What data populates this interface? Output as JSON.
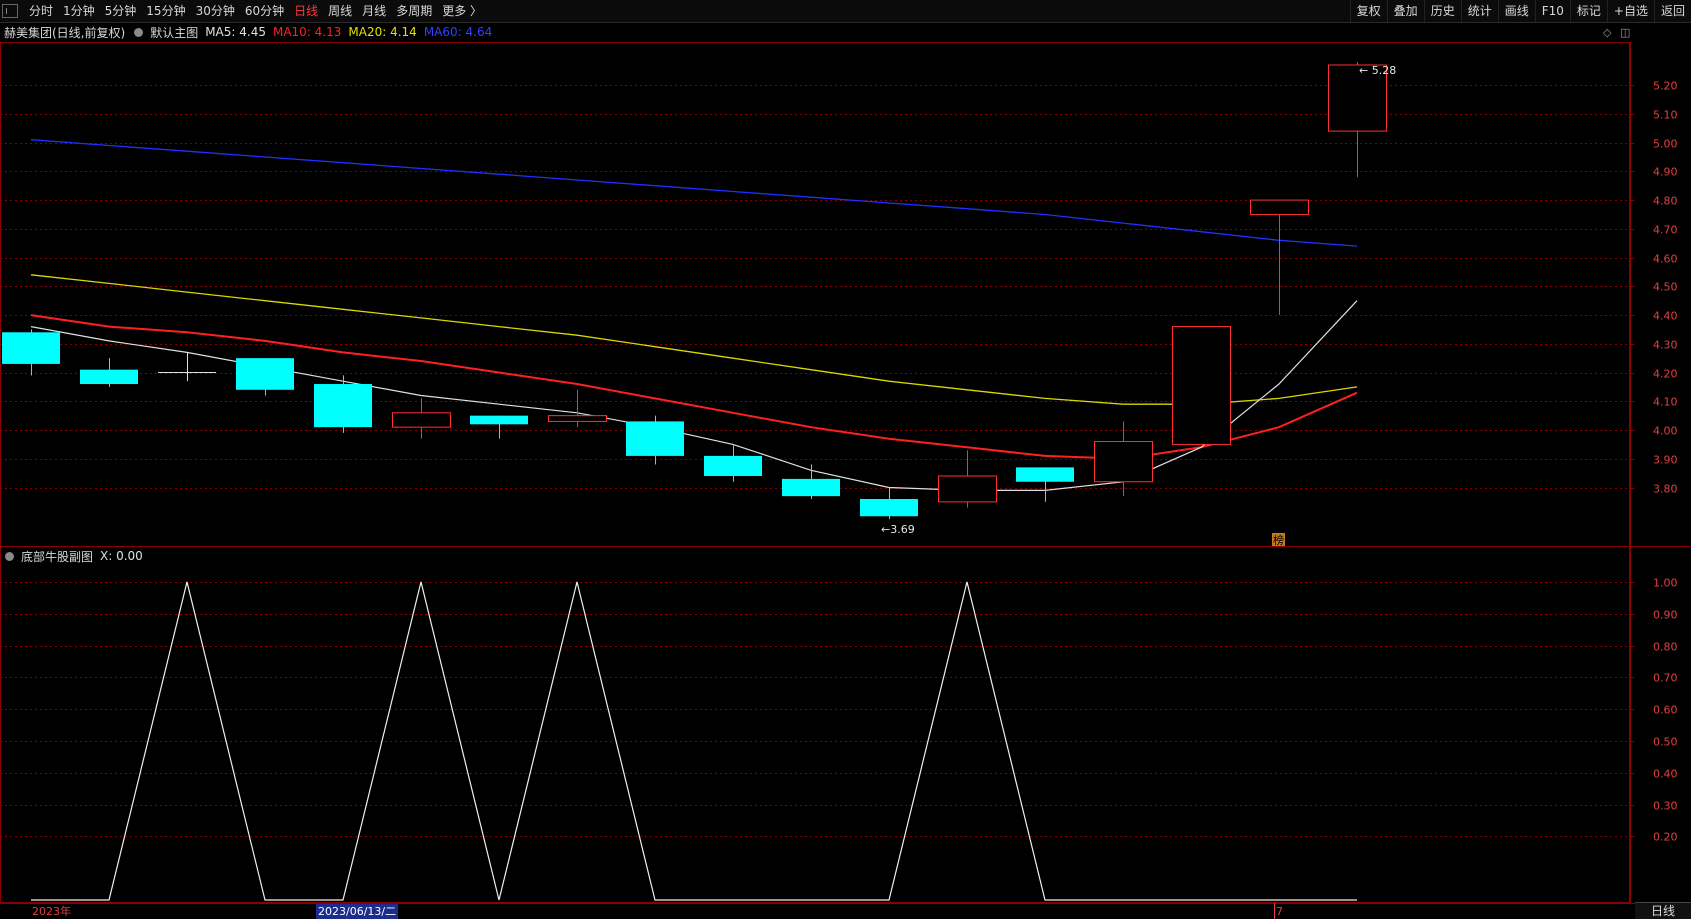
{
  "toolbar": {
    "periods": [
      "分时",
      "1分钟",
      "5分钟",
      "15分钟",
      "30分钟",
      "60分钟",
      "日线",
      "周线",
      "月线",
      "多周期",
      "更多 〉"
    ],
    "active_index": 6,
    "tools": [
      "复权",
      "叠加",
      "历史",
      "统计",
      "画线",
      "F10",
      "标记",
      "+自选",
      "返回"
    ]
  },
  "main_chart": {
    "title": "赫美集团(日线,前复权)",
    "indicator_name": "默认主图",
    "ma5": "MA5: 4.45",
    "ma10": "MA10: 4.13",
    "ma20": "MA20: 4.14",
    "ma60": "MA60: 4.64",
    "high_marker": "5.28",
    "low_marker": "3.69",
    "badge": "榜",
    "colors": {
      "ma5": "#e0e0e0",
      "ma10": "#ff2020",
      "ma20": "#d8d800",
      "ma60": "#2030ff",
      "up": "#ff3030",
      "down": "#00ffff",
      "grid": "#8b0000"
    }
  },
  "sub_chart": {
    "title": "底部牛股副图",
    "value": "X: 0.00"
  },
  "bottom_axis": {
    "year_label": "2023年",
    "date_label": "2023/06/13/二",
    "month_label": "7"
  },
  "period_tag": "日线",
  "chart_data": [
    {
      "type": "candlestick",
      "title": "赫美集团(日线,前复权)",
      "ylim": [
        3.6,
        5.35
      ],
      "yticks": [
        3.8,
        3.9,
        4.0,
        4.1,
        4.2,
        4.3,
        4.4,
        4.5,
        4.6,
        4.7,
        4.8,
        4.9,
        5.0,
        5.1,
        5.2
      ],
      "candles": [
        {
          "open": 4.34,
          "close": 4.23,
          "high": 4.35,
          "low": 4.19
        },
        {
          "open": 4.21,
          "close": 4.16,
          "high": 4.25,
          "low": 4.15
        },
        {
          "open": 4.2,
          "close": 4.2,
          "high": 4.27,
          "low": 4.17
        },
        {
          "open": 4.25,
          "close": 4.14,
          "high": 4.25,
          "low": 4.12
        },
        {
          "open": 4.16,
          "close": 4.01,
          "high": 4.19,
          "low": 3.99
        },
        {
          "open": 4.01,
          "close": 4.06,
          "high": 4.11,
          "low": 3.97
        },
        {
          "open": 4.05,
          "close": 4.02,
          "high": 4.05,
          "low": 3.97
        },
        {
          "open": 4.03,
          "close": 4.05,
          "high": 4.14,
          "low": 4.01
        },
        {
          "open": 4.03,
          "close": 3.91,
          "high": 4.05,
          "low": 3.88
        },
        {
          "open": 3.91,
          "close": 3.84,
          "high": 3.95,
          "low": 3.82
        },
        {
          "open": 3.83,
          "close": 3.77,
          "high": 3.88,
          "low": 3.76
        },
        {
          "open": 3.76,
          "close": 3.7,
          "high": 3.8,
          "low": 3.69
        },
        {
          "open": 3.75,
          "close": 3.84,
          "high": 3.93,
          "low": 3.73
        },
        {
          "open": 3.87,
          "close": 3.82,
          "high": 3.87,
          "low": 3.75
        },
        {
          "open": 3.82,
          "close": 3.96,
          "high": 4.03,
          "low": 3.77
        },
        {
          "open": 3.95,
          "close": 4.36,
          "high": 4.36,
          "low": 3.95
        },
        {
          "open": 4.75,
          "close": 4.8,
          "high": 4.8,
          "low": 4.4
        },
        {
          "open": 5.04,
          "close": 5.27,
          "high": 5.28,
          "low": 4.88
        }
      ],
      "ma5": [
        4.36,
        4.31,
        4.27,
        4.22,
        4.17,
        4.12,
        4.09,
        4.06,
        4.01,
        3.95,
        3.86,
        3.8,
        3.79,
        3.79,
        3.82,
        3.94,
        4.16,
        4.45
      ],
      "ma10": [
        4.4,
        4.36,
        4.34,
        4.31,
        4.27,
        4.24,
        4.2,
        4.16,
        4.11,
        4.06,
        4.01,
        3.97,
        3.94,
        3.91,
        3.9,
        3.94,
        4.01,
        4.13
      ],
      "ma20": [
        4.54,
        4.51,
        4.48,
        4.45,
        4.42,
        4.39,
        4.36,
        4.33,
        4.29,
        4.25,
        4.21,
        4.17,
        4.14,
        4.11,
        4.09,
        4.09,
        4.11,
        4.15
      ],
      "ma60": [
        5.01,
        4.99,
        4.97,
        4.95,
        4.93,
        4.91,
        4.89,
        4.87,
        4.85,
        4.83,
        4.81,
        4.79,
        4.77,
        4.75,
        4.72,
        4.69,
        4.66,
        4.64
      ]
    },
    {
      "type": "line",
      "title": "底部牛股副图",
      "ylim": [
        0,
        1.05
      ],
      "yticks": [
        0.2,
        0.3,
        0.4,
        0.5,
        0.6,
        0.7,
        0.8,
        0.9,
        1.0
      ],
      "x_points": [
        0,
        1,
        2,
        3,
        4,
        5,
        6,
        7,
        8,
        9,
        10,
        11,
        12,
        13,
        14,
        15,
        16,
        17
      ],
      "values": [
        0,
        0,
        1,
        0,
        0,
        1,
        0,
        1,
        0,
        0,
        0,
        0,
        1,
        0,
        0,
        0,
        0,
        0
      ]
    }
  ]
}
